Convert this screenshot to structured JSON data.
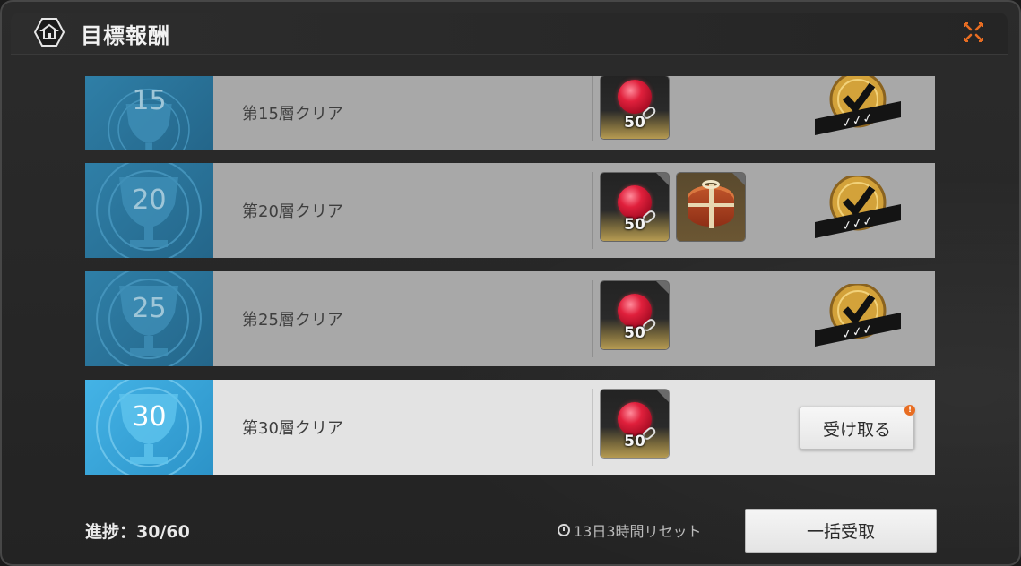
{
  "header": {
    "title": "目標報酬"
  },
  "rows": [
    {
      "floor": "15",
      "condition": "第15層クリア",
      "rewards": [
        {
          "type": "red-gem",
          "qty": "50"
        }
      ],
      "status": "claimed"
    },
    {
      "floor": "20",
      "condition": "第20層クリア",
      "rewards": [
        {
          "type": "red-gem",
          "qty": "50"
        },
        {
          "type": "gift-box",
          "qty": ""
        }
      ],
      "status": "claimed"
    },
    {
      "floor": "25",
      "condition": "第25層クリア",
      "rewards": [
        {
          "type": "red-gem",
          "qty": "50"
        }
      ],
      "status": "claimed"
    },
    {
      "floor": "30",
      "condition": "第30層クリア",
      "rewards": [
        {
          "type": "red-gem",
          "qty": "50"
        }
      ],
      "status": "claimable",
      "claim_label": "受け取る",
      "alert": "!"
    }
  ],
  "footer": {
    "progress": "進捗：30/60",
    "reset": "13日3時間リセット",
    "bulk_label": "一括受取"
  },
  "colors": {
    "badge_blue": "#2f7fa7",
    "badge_blue_active": "#44b3e6",
    "stamp_gold": "#d3a23a",
    "accent_orange": "#e86d22"
  }
}
